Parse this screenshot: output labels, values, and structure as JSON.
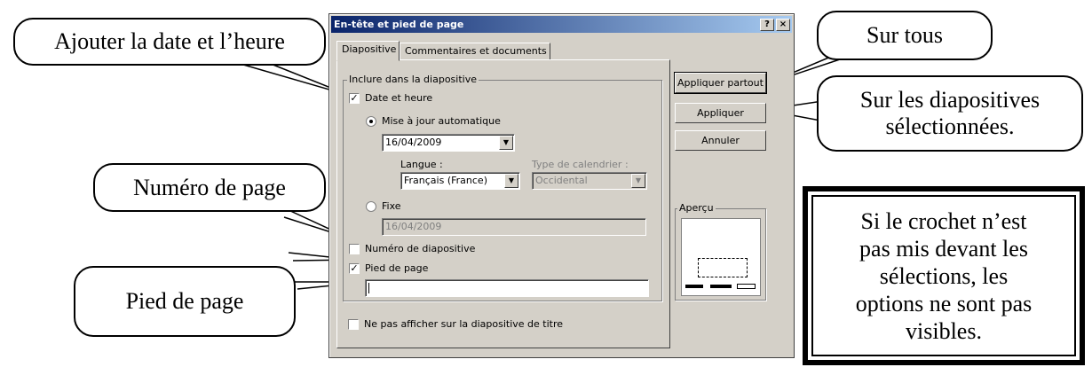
{
  "callouts": {
    "date_time": "Ajouter la date et l’heure",
    "page_number": "Numéro de page",
    "footer": "Pied de page",
    "apply_all": "Sur tous",
    "apply_selected": [
      "Sur les diapositives",
      "sélectionnées."
    ],
    "note": [
      "Si le crochet n’est",
      "pas mis devant les",
      "sélections, les",
      "options ne sont pas",
      "visibles."
    ]
  },
  "dialog": {
    "title": "En-tête et pied de page",
    "help_button": "?",
    "close_button": "×",
    "tabs": [
      "Diapositive",
      "Commentaires et documents"
    ],
    "group_label": "Inclure dans la diapositive",
    "date_time": {
      "label": "Date et heure",
      "checked": true
    },
    "auto_update": {
      "label": "Mise à jour automatique",
      "selected": true,
      "value": "16/04/2009"
    },
    "language": {
      "label": "Langue :",
      "value": "Français (France)"
    },
    "calendar": {
      "label": "Type de calendrier :",
      "value": "Occidental"
    },
    "fixed": {
      "label": "Fixe",
      "selected": false,
      "value": "16/04/2009"
    },
    "slide_number": {
      "label": "Numéro de diapositive",
      "checked": false
    },
    "footer": {
      "label": "Pied de page",
      "checked": true,
      "value": ""
    },
    "hide_title": {
      "label": "Ne pas afficher sur la diapositive de titre",
      "checked": false
    },
    "buttons": {
      "apply_all": "Appliquer partout",
      "apply": "Appliquer",
      "cancel": "Annuler"
    },
    "preview_label": "Aperçu"
  }
}
